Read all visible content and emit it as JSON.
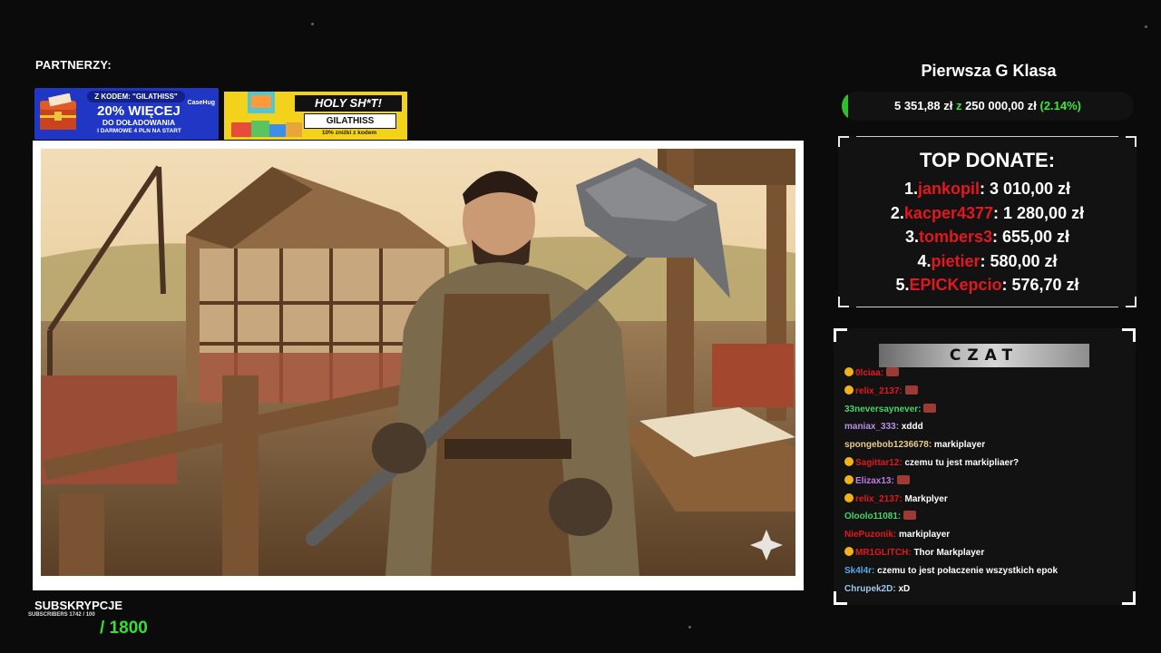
{
  "partners": {
    "label": "PARTNERZY:",
    "casehug": {
      "code_line": "Z KODEM: \"GILATHISS\"",
      "headline": "20% WIĘCEJ",
      "line2": "DO DOŁADOWANIA",
      "line3": "I DARMOWE 4 PLN NA START",
      "brand": "CaseHug"
    },
    "holy": {
      "title": "HOLY SH*T!",
      "code": "GILATHISS",
      "sub": "10% zniżki z kodem"
    }
  },
  "subs": {
    "label": "SUBSKRYPCJE",
    "tiny": "SUBSCRIBERS 1742 / 100",
    "count": "/ 1800"
  },
  "goal": {
    "title": "Pierwsza G Klasa",
    "current": "5 351,88 zł",
    "sep": "z",
    "target": "250 000,00 zł",
    "percent": "(2.14%)",
    "progress_fraction": 0.0214
  },
  "top_donate": {
    "title": "TOP DONATE:",
    "rows": [
      {
        "rank": "1.",
        "name": "jankopil",
        "amount": ": 3 010,00 zł"
      },
      {
        "rank": "2.",
        "name": "kacper4377",
        "amount": ": 1 280,00 zł"
      },
      {
        "rank": "3.",
        "name": "tombers3",
        "amount": ": 655,00 zł"
      },
      {
        "rank": "4.",
        "name": "pietier",
        "amount": ": 580,00 zł"
      },
      {
        "rank": "5.",
        "name": "EPICKepcio",
        "amount": ": 576,70 zł"
      }
    ]
  },
  "chat": {
    "header": "CZAT",
    "messages": [
      {
        "badge": true,
        "user": "0lciaa:",
        "color": "#e3171f",
        "text": "",
        "emote": true
      },
      {
        "badge": true,
        "user": "relix_2137:",
        "color": "#e3171f",
        "text": "",
        "emote": true
      },
      {
        "badge": false,
        "user": "33neversaynever:",
        "color": "#47d36a",
        "text": "",
        "emote": true
      },
      {
        "badge": false,
        "user": "maniax_333:",
        "color": "#b78ee8",
        "text": "xddd",
        "emote": false
      },
      {
        "badge": false,
        "user": "spongebob1236678:",
        "color": "#e8c98a",
        "text": "markiplayer",
        "emote": false
      },
      {
        "badge": true,
        "user": "Sagittar12:",
        "color": "#e3171f",
        "text": "czemu tu jest markipliaer?",
        "emote": false
      },
      {
        "badge": true,
        "user": "Elizax13:",
        "color": "#c17be8",
        "text": "",
        "emote": true
      },
      {
        "badge": true,
        "user": "relix_2137:",
        "color": "#e3171f",
        "text": "Markplyer",
        "emote": false
      },
      {
        "badge": false,
        "user": "Oloolo11081:",
        "color": "#47d36a",
        "text": "",
        "emote": true
      },
      {
        "badge": false,
        "user": "NiePuzonik:",
        "color": "#e3171f",
        "text": "markiplayer",
        "emote": false
      },
      {
        "badge": true,
        "user": "MR1GLITCH:",
        "color": "#e3171f",
        "text": "Thor Markplayer",
        "emote": false
      },
      {
        "badge": false,
        "user": "Sk4l4r:",
        "color": "#5aa7e8",
        "text": "czemu to jest połaczenie wszystkich epok",
        "emote": false
      },
      {
        "badge": false,
        "user": "Chrupek2D:",
        "color": "#9fc7e8",
        "text": "xD",
        "emote": false
      }
    ]
  },
  "colors": {
    "accent_green": "#35e02f",
    "donate_red": "#e3171f",
    "panel": "#121212"
  }
}
